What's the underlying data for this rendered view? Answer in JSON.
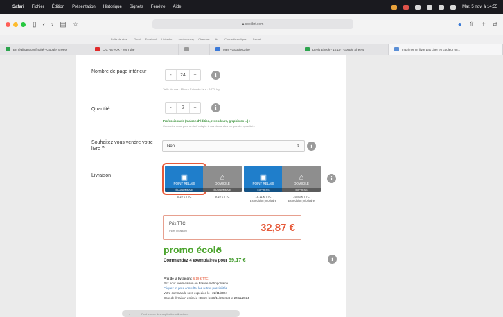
{
  "menubar": {
    "apple": "",
    "items": [
      "Safari",
      "Fichier",
      "Édition",
      "Présentation",
      "Historique",
      "Signets",
      "Fenêtre",
      "Aide"
    ],
    "clock": "Mar. 5 nov. à 14:55"
  },
  "toolbar": {
    "url": "coolibri.com"
  },
  "favorites": [
    "Boîte de réce...",
    "Gmail",
    "Facebook",
    "LinkedIn",
    "...en discovery",
    "Chercher",
    "..ikt...",
    "Convertir en ligne...",
    "Secret"
  ],
  "tabs": [
    {
      "label": "En réalisant confinuité - Google Sheets",
      "color": "#2da44e"
    },
    {
      "label": "CIC REVOX - YouTube",
      "color": "#e02a2a"
    },
    {
      "label": "",
      "color": "#999999"
    },
    {
      "label": "Mes - Google Drive",
      "color": "#3b79d8"
    },
    {
      "label": "Devis Ebook - 10.19 - Google Sheets",
      "color": "#2da44e"
    },
    {
      "label": "Imprimer un livre pas cher en couleur ou...",
      "color": "#5b8fd6"
    }
  ],
  "form": {
    "pages_label": "Nombre de page intérieur",
    "pages_value": "24",
    "pages_hint": "Taille du dos : 15 mm   Poids du livre : 0.770 kg",
    "quantity_label": "Quantité",
    "quantity_value": "2",
    "quantity_hint_green": "Professionnels (maison d'édition, revendeurs, graphistes ...) :",
    "quantity_hint": "Contactez nous pour un tarif adapté à vos demandes en grandes quantités",
    "sell_label": "Souhaitez vous vendre votre livre ?",
    "sell_value": "Non",
    "delivery_label": "Livraison",
    "minus": "-",
    "plus": "+",
    "info": "i"
  },
  "delivery_options": [
    {
      "title": "POINT RELAIS",
      "strip": "ÉCONOMIQUE",
      "price": "6,19 € TTC",
      "note": "",
      "color": "blue",
      "selected": true
    },
    {
      "title": "DOMICILE",
      "strip": "ÉCONOMIQUE",
      "price": "9,19 € TTC",
      "note": "",
      "color": "grey",
      "selected": false
    },
    {
      "title": "POINT RELAIS",
      "strip": "EXPRESS",
      "price": "18,11 € TTC",
      "note": "Expédition prioritaire",
      "color": "blue",
      "selected": false
    },
    {
      "title": "DOMICILE",
      "strip": "EXPRESS",
      "price": "20,83 € TTC",
      "note": "Expédition prioritaire",
      "color": "grey",
      "selected": false
    }
  ],
  "price": {
    "label": "Prix TTC",
    "sublabel": "(hors livraison)",
    "value": "32,87 €"
  },
  "promo": {
    "logo": "promo écolo",
    "text": "Commandez 4 exemplaires pour",
    "amount": "59,17 €"
  },
  "delivery_info": {
    "line1_label": "Prix de la livraison :",
    "line1_value": "6,19 € TTC",
    "line2": "Prix pour une livraison en France métropolitaine",
    "line3": "Cliquez ici pour consulter les autres possibilités",
    "line4": "Votre commande sera expédiée le : 22/11/2024",
    "line5": "Date de livraison estimée : Entre le 26/11/2024 et le 27/11/2024"
  },
  "dock": {
    "text": "Rechercher des applications & actions"
  },
  "colors": {
    "accent": "#e65a3a",
    "green": "#4da52f",
    "blue": "#1f7ecb"
  }
}
